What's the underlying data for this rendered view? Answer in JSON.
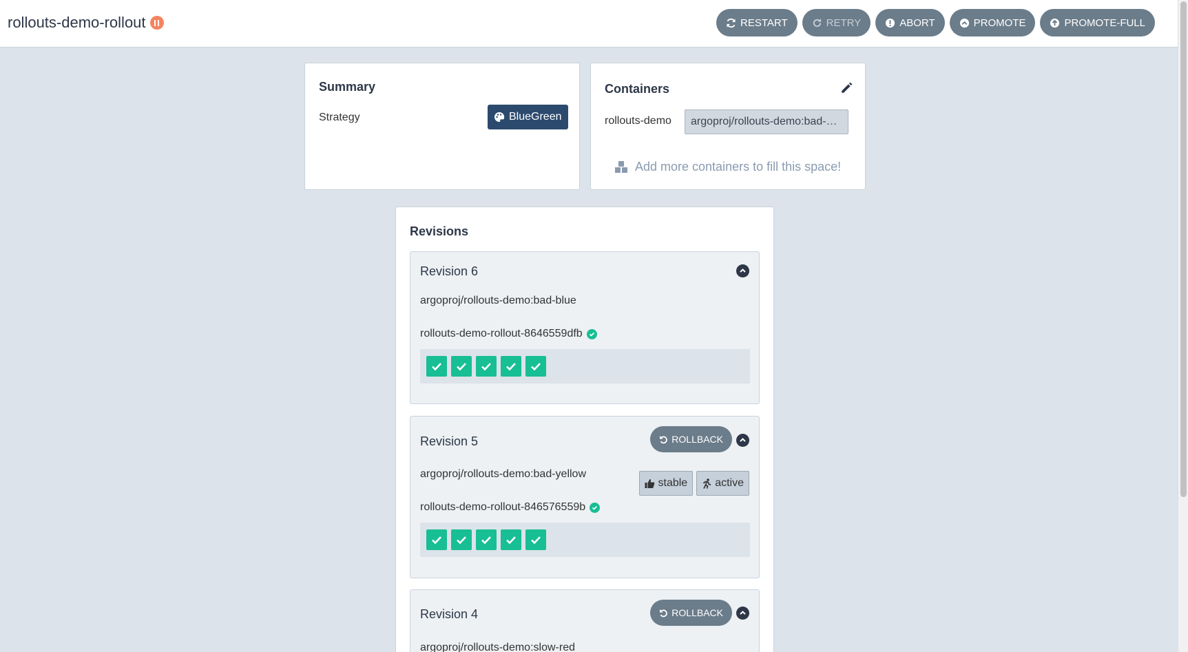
{
  "header": {
    "title": "rollouts-demo-rollout",
    "status_icon": "pause-circle-icon",
    "status_color": "#f4845f"
  },
  "actions": [
    {
      "label": "RESTART",
      "icon": "sync-icon",
      "disabled": false
    },
    {
      "label": "RETRY",
      "icon": "redo-icon",
      "disabled": true
    },
    {
      "label": "ABORT",
      "icon": "exclamation-circle-icon",
      "disabled": false
    },
    {
      "label": "PROMOTE",
      "icon": "chevron-circle-up-icon",
      "disabled": false
    },
    {
      "label": "PROMOTE-FULL",
      "icon": "arrow-circle-up-icon",
      "disabled": false
    }
  ],
  "summary": {
    "title": "Summary",
    "strategy_label": "Strategy",
    "strategy_value": "BlueGreen",
    "strategy_icon": "palette-icon"
  },
  "containers": {
    "title": "Containers",
    "edit_icon": "pencil-icon",
    "items": [
      {
        "name": "rollouts-demo",
        "image": "argoproj/rollouts-demo:bad-yellow"
      }
    ],
    "add_more_text": "Add more containers to fill this space!"
  },
  "revisions": {
    "title": "Revisions",
    "rollback_label": "ROLLBACK",
    "items": [
      {
        "title": "Revision 6",
        "image": "argoproj/rollouts-demo:bad-blue",
        "replicaset": "rollouts-demo-rollout-8646559dfb",
        "pods": 5,
        "rollback": false,
        "tags": []
      },
      {
        "title": "Revision 5",
        "image": "argoproj/rollouts-demo:bad-yellow",
        "replicaset": "rollouts-demo-rollout-846576559b",
        "pods": 5,
        "rollback": true,
        "tags": [
          "stable",
          "active"
        ]
      },
      {
        "title": "Revision 4",
        "image": "argoproj/rollouts-demo:slow-red",
        "rollback": true,
        "tags": []
      }
    ]
  },
  "colors": {
    "healthy": "#18be94",
    "button": "#6b7c8a",
    "strategy_badge": "#2c4a6e",
    "background": "#dce3ea"
  }
}
